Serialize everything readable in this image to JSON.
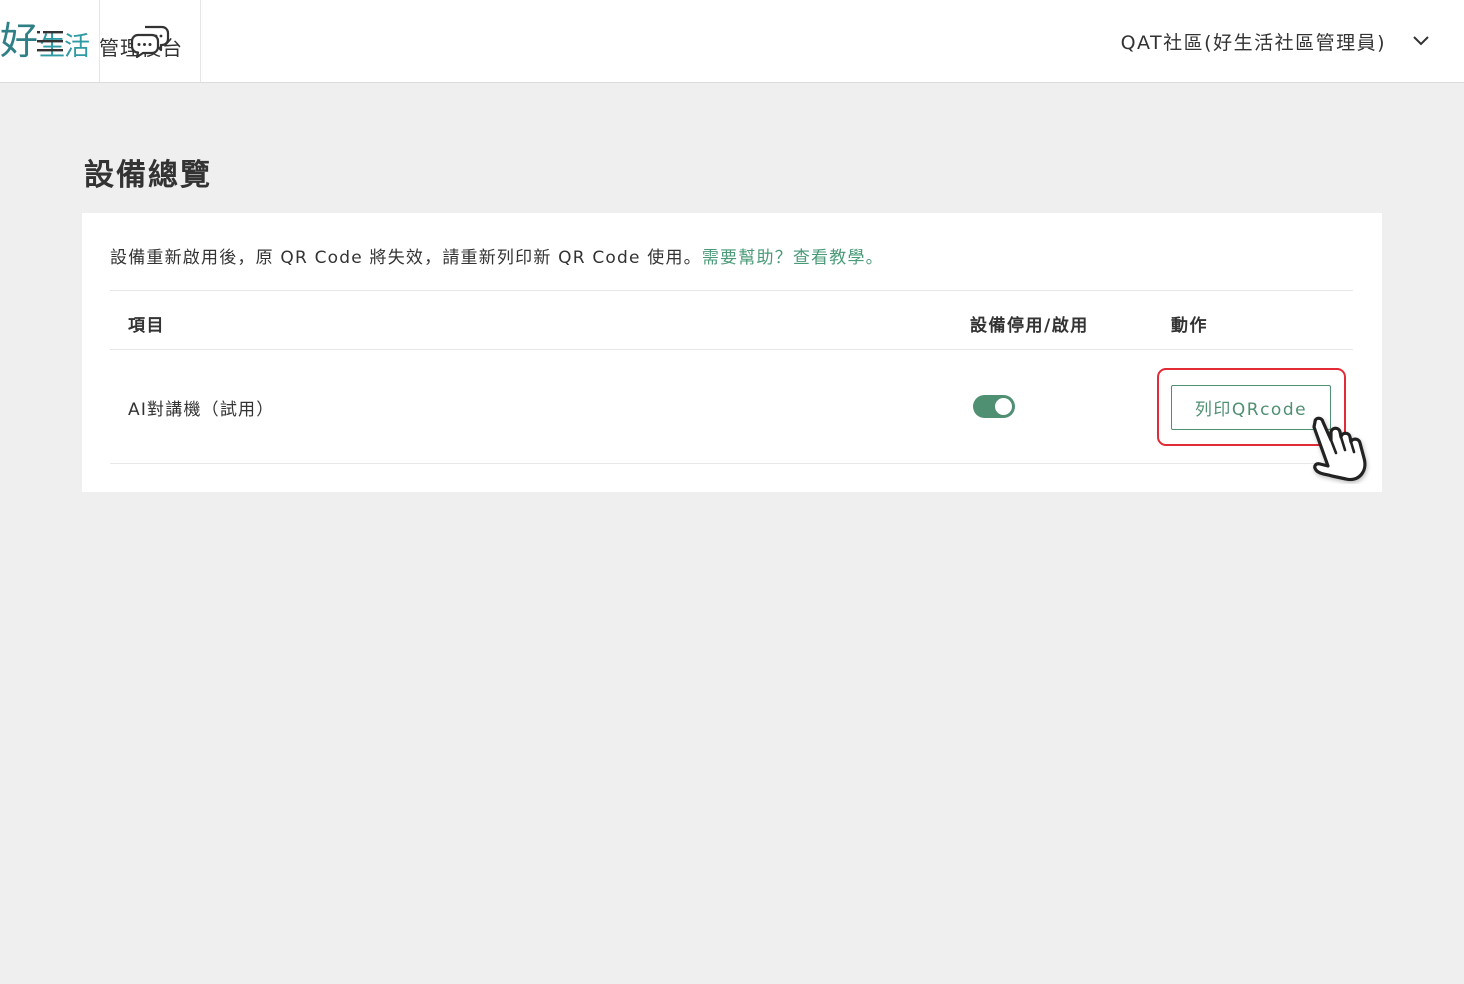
{
  "header": {
    "logo_main": "好",
    "logo_rest": "生活",
    "logo_sub": "管理後台",
    "community": "QAT社區(好生活社區管理員)"
  },
  "page": {
    "title": "設備總覽"
  },
  "notice": {
    "text": "設備重新啟用後，原 QR Code 將失效，請重新列印新 QR Code 使用。",
    "help_link": "需要幫助？查看教學。"
  },
  "table": {
    "headers": {
      "item": "項目",
      "toggle": "設備停用/啟用",
      "action": "動作"
    },
    "rows": [
      {
        "item": "AI對講機（試用）",
        "enabled": true,
        "action_label": "列印QRcode"
      }
    ]
  },
  "colors": {
    "accent": "#4f8f72",
    "highlight": "#e22b36",
    "logo": "#2e7f86"
  }
}
